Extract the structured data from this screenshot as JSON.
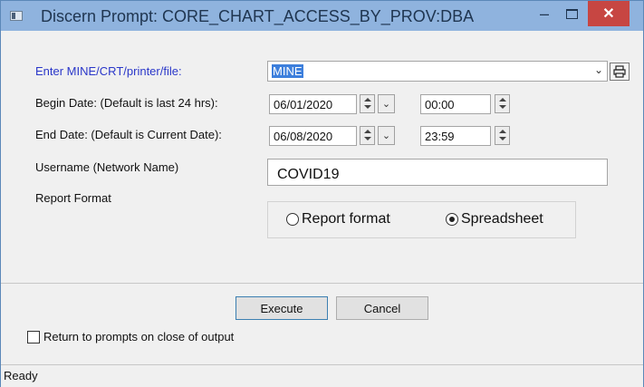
{
  "window": {
    "title": "Discern Prompt: CORE_CHART_ACCESS_BY_PROV:DBA",
    "minimize_glyph": "–",
    "close_glyph": "✕"
  },
  "prompts": {
    "output": {
      "label": "Enter MINE/CRT/printer/file:",
      "value": "MINE",
      "dropdown_glyph": "⌄"
    },
    "begin_date": {
      "label": "Begin Date: (Default is last 24 hrs):",
      "date": "06/01/2020",
      "time": "00:00"
    },
    "end_date": {
      "label": "End Date: (Default is Current Date):",
      "date": "06/08/2020",
      "time": "23:59"
    },
    "username": {
      "label": "Username (Network Name)",
      "value": "COVID19"
    },
    "report_format": {
      "label": "Report Format",
      "options": [
        "Report format",
        "Spreadsheet"
      ],
      "selected": "Spreadsheet"
    }
  },
  "buttons": {
    "execute": "Execute",
    "cancel": "Cancel"
  },
  "options": {
    "return_to_prompts": "Return to prompts on close of output"
  },
  "status": {
    "text": "Ready"
  },
  "colors": {
    "titlebar": "#8fb3de",
    "close_button": "#c74642",
    "label_accent": "#2a37c9",
    "selection": "#3d7fdc"
  },
  "icons": {
    "title": "app-window-icon",
    "printer": "printer-icon",
    "spinner": "spin-updown-icon",
    "calendar": "chevron-down-icon"
  }
}
